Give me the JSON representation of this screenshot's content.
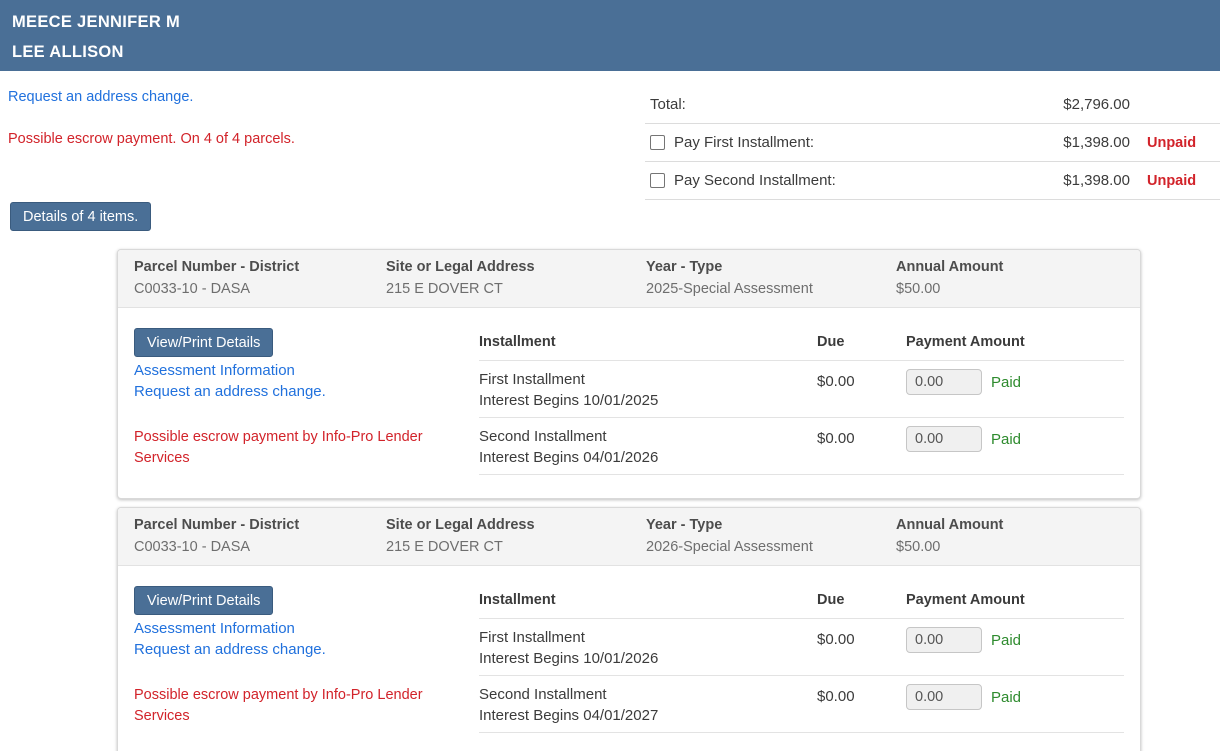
{
  "header": {
    "names": {
      "line1": "MEECE JENNIFER M",
      "line2": "LEE ALLISON"
    }
  },
  "messages": {
    "address_change_link": "Request an address change.",
    "escrow_notice": "Possible escrow payment. On 4 of 4 parcels."
  },
  "totals": {
    "rows": [
      {
        "label": "Total:",
        "amount": "$2,796.00",
        "status": ""
      },
      {
        "label": "Pay First Installment:",
        "amount": "$1,398.00",
        "status": "Unpaid"
      },
      {
        "label": "Pay Second Installment:",
        "amount": "$1,398.00",
        "status": "Unpaid"
      }
    ]
  },
  "details_button_label": "Details of 4 items.",
  "parcel_header_labels": {
    "parcel": "Parcel Number - District",
    "site": "Site or Legal Address",
    "year": "Year - Type",
    "annual": "Annual Amount"
  },
  "installment_headers": {
    "installment": "Installment",
    "due": "Due",
    "payment": "Payment Amount"
  },
  "card_actions": {
    "view_print": "View/Print Details",
    "assessment_link": "Assessment Information",
    "address_link": "Request an address change.",
    "escrow_note": "Possible escrow payment by Info-Pro Lender Services"
  },
  "parcels": [
    {
      "parcel": "C0033-10 - DASA",
      "site": "215 E DOVER CT",
      "year": "2025-Special Assessment",
      "annual": "$50.00",
      "installments": [
        {
          "name": "First Installment",
          "interest": "Interest Begins 10/01/2025",
          "due": "$0.00",
          "payment": "0.00",
          "status": "Paid"
        },
        {
          "name": "Second Installment",
          "interest": "Interest Begins 04/01/2026",
          "due": "$0.00",
          "payment": "0.00",
          "status": "Paid"
        }
      ]
    },
    {
      "parcel": "C0033-10 - DASA",
      "site": "215 E DOVER CT",
      "year": "2026-Special Assessment",
      "annual": "$50.00",
      "installments": [
        {
          "name": "First Installment",
          "interest": "Interest Begins 10/01/2026",
          "due": "$0.00",
          "payment": "0.00",
          "status": "Paid"
        },
        {
          "name": "Second Installment",
          "interest": "Interest Begins 04/01/2027",
          "due": "$0.00",
          "payment": "0.00",
          "status": "Paid"
        }
      ]
    }
  ],
  "colors": {
    "header_bg": "#4a6f96",
    "button_bg": "#4a6f96",
    "button_border": "#3a5b7e",
    "link_blue": "#2171dd",
    "alert_red": "#d2232a",
    "paid_green": "#2e8b2e",
    "card_header_bg": "#f4f4f4",
    "card_border": "#d9d9d9"
  }
}
